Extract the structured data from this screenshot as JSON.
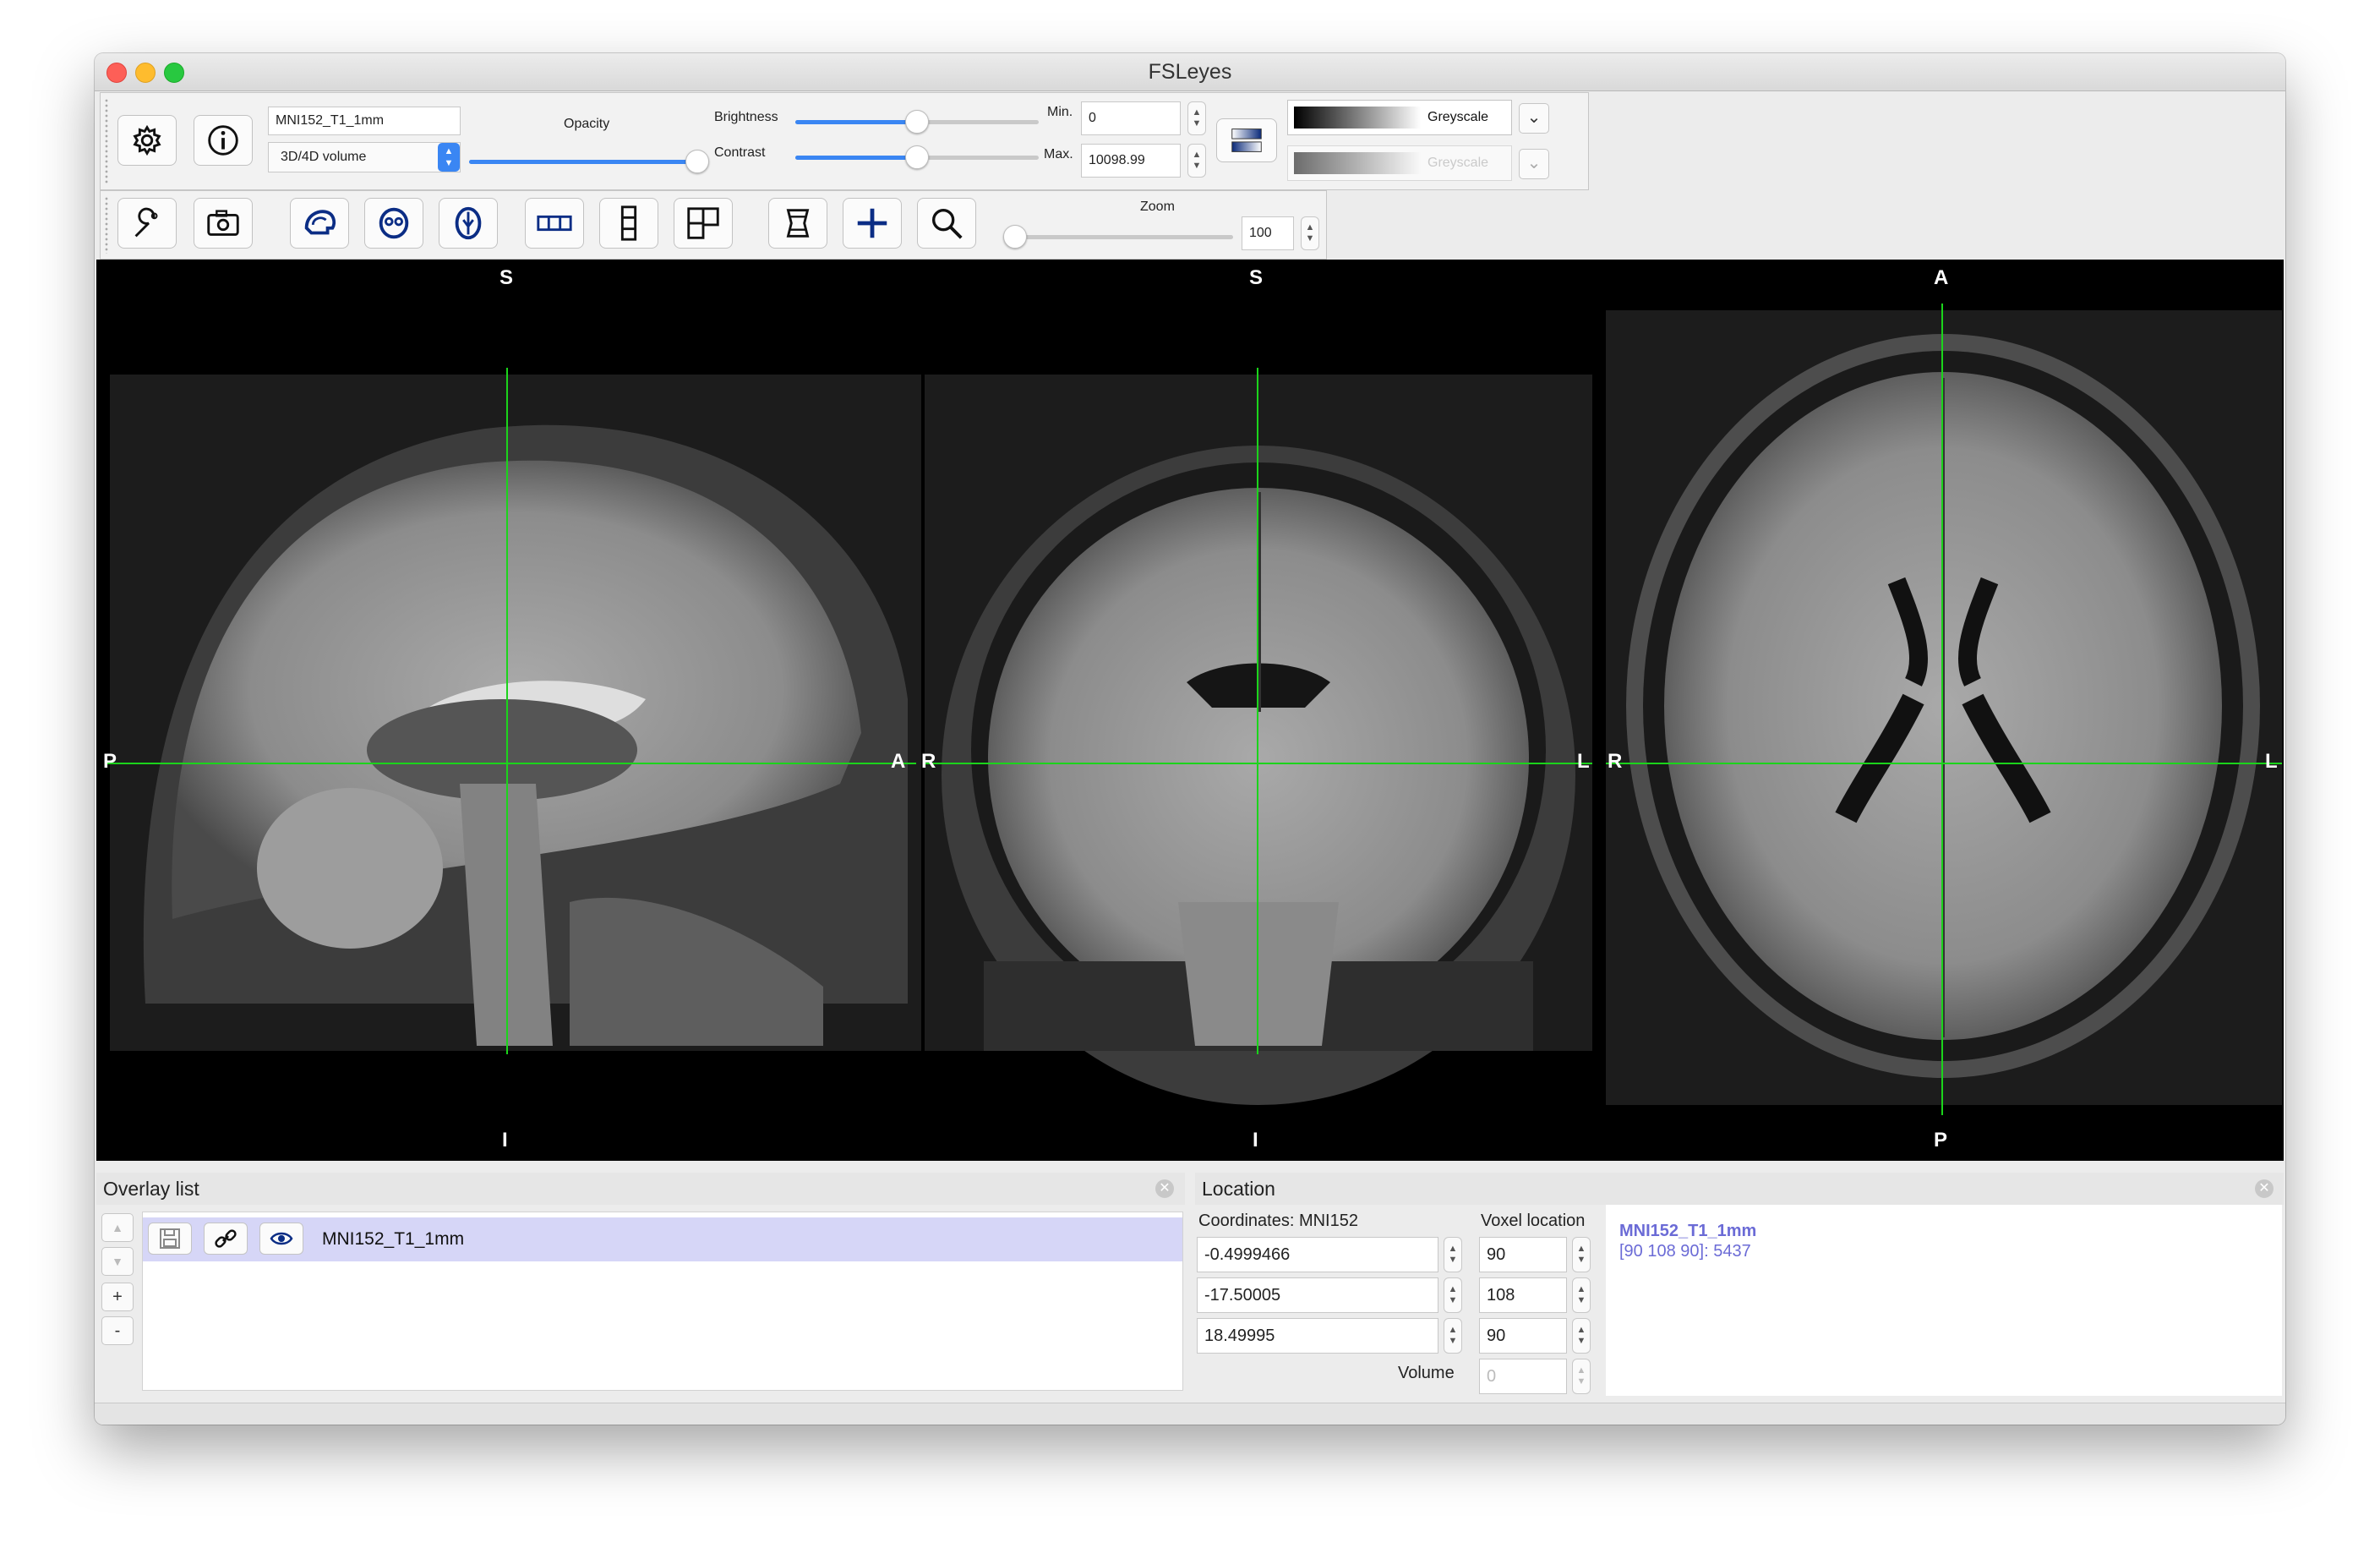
{
  "window": {
    "title": "FSLeyes"
  },
  "overlay_toolbar": {
    "overlay_name": "MNI152_T1_1mm",
    "overlay_type": "3D/4D volume",
    "opacity_label": "Opacity",
    "opacity_fraction": 1.0,
    "brightness_label": "Brightness",
    "brightness_fraction": 0.5,
    "contrast_label": "Contrast",
    "contrast_fraction": 0.5,
    "min_label": "Min.",
    "min_value": "0",
    "max_label": "Max.",
    "max_value": "10098.99",
    "colormap": "Greyscale",
    "neg_colormap": "Greyscale"
  },
  "ortho_toolbar": {
    "zoom_label": "Zoom",
    "zoom_value": "100",
    "zoom_fraction": 0.0
  },
  "views": {
    "sagittal": {
      "top": "S",
      "bottom": "I",
      "left": "P",
      "right": "A"
    },
    "coronal": {
      "top": "S",
      "bottom": "I",
      "left": "R",
      "right": "L"
    },
    "axial": {
      "top": "A",
      "bottom": "P",
      "left": "R",
      "right": "L"
    }
  },
  "overlay_list": {
    "title": "Overlay list",
    "up": "▲",
    "down": "▼",
    "add": "+",
    "remove": "-",
    "items": [
      {
        "name": "MNI152_T1_1mm"
      }
    ]
  },
  "location": {
    "title": "Location",
    "coord_label": "Coordinates: MNI152",
    "voxel_label": "Voxel location",
    "world": [
      "-0.4999466",
      "-17.50005",
      "18.49995"
    ],
    "voxel": [
      "90",
      "108",
      "90"
    ],
    "volume_label": "Volume",
    "volume_value": "0",
    "info_name": "MNI152_T1_1mm",
    "info_value": "[90 108 90]: 5437",
    "info_color": "#6b6bd6"
  },
  "colors": {
    "crosshair": "#1bd41b",
    "accent": "#3a86f3",
    "selected_row": "#d6d6f7"
  }
}
